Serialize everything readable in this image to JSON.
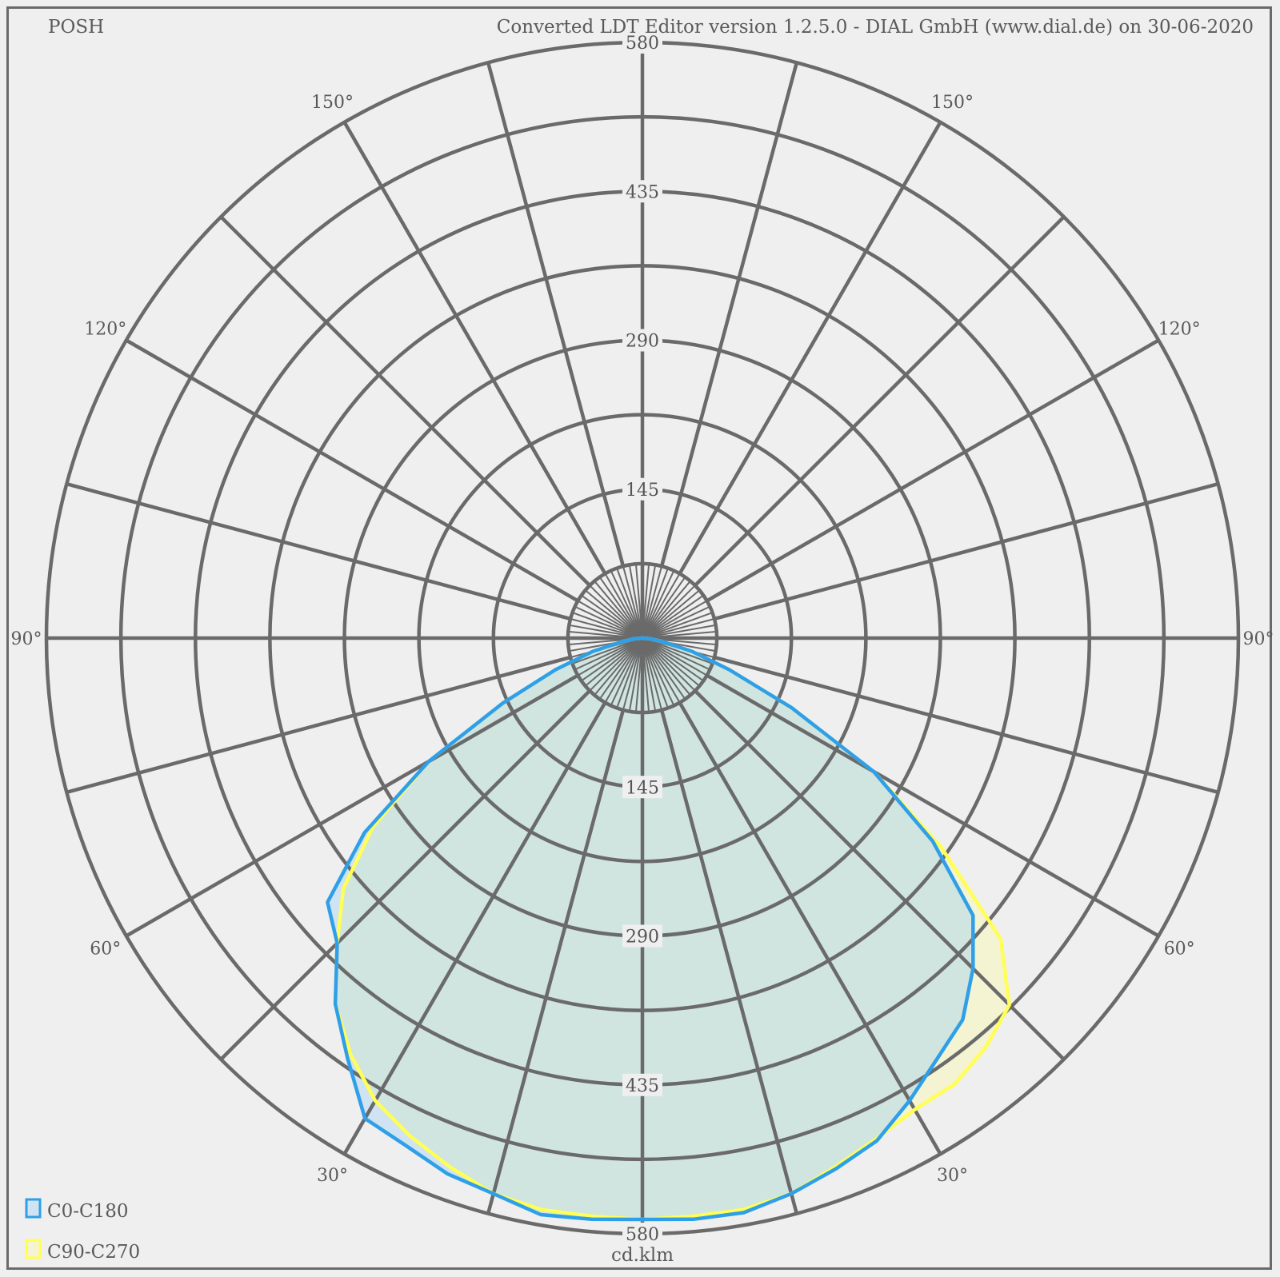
{
  "header": {
    "left_text": "POSH",
    "right_text": "Converted LDT Editor version 1.2.5.0 - DIAL GmbH (www.dial.de) on 30-06-2020"
  },
  "chart_data": {
    "type": "polar",
    "unit": "cd.klm",
    "rmax": 580,
    "radial_labels": [
      "145",
      "290",
      "435",
      "580"
    ],
    "angle_labels": [
      {
        "deg": 30,
        "text": "30°"
      },
      {
        "deg": 60,
        "text": "60°"
      },
      {
        "deg": 90,
        "text": "90°"
      },
      {
        "deg": 120,
        "text": "120°"
      },
      {
        "deg": 150,
        "text": "150°"
      }
    ],
    "colors": {
      "grid": "#6a6a6a",
      "series_c0": "#2e9fe8",
      "series_c0_fill": "#cfe3f2",
      "series_c90": "#ffff55",
      "series_c90_fill": "#f4f3d2",
      "overlap_fill": "#d0e4e0"
    },
    "series": [
      {
        "name": "C0-C180",
        "gamma": [
          0,
          5,
          10,
          15,
          20,
          25,
          30,
          35,
          40,
          45,
          50,
          55,
          60,
          65,
          70,
          75,
          80,
          85,
          90
        ],
        "left": [
          566,
          568,
          570,
          560,
          555,
          545,
          540,
          500,
          465,
          420,
          400,
          330,
          240,
          150,
          90,
          50,
          20,
          8,
          0
        ],
        "right": [
          566,
          568,
          568,
          560,
          550,
          540,
          520,
          500,
          485,
          455,
          420,
          345,
          260,
          160,
          90,
          50,
          20,
          8,
          0
        ]
      },
      {
        "name": "C90-C270",
        "gamma": [
          0,
          5,
          10,
          15,
          20,
          25,
          30,
          35,
          40,
          45,
          50,
          55,
          60,
          65,
          70,
          75,
          80,
          85,
          90
        ],
        "left": [
          566,
          565,
          565,
          560,
          548,
          535,
          520,
          495,
          465,
          420,
          380,
          320,
          240,
          150,
          90,
          50,
          20,
          8,
          0
        ],
        "right": [
          566,
          565,
          565,
          560,
          548,
          538,
          530,
          530,
          520,
          505,
          455,
          355,
          260,
          160,
          90,
          50,
          20,
          8,
          0
        ]
      }
    ],
    "legend": [
      {
        "label": "C0-C180"
      },
      {
        "label": "C90-C270"
      }
    ]
  }
}
